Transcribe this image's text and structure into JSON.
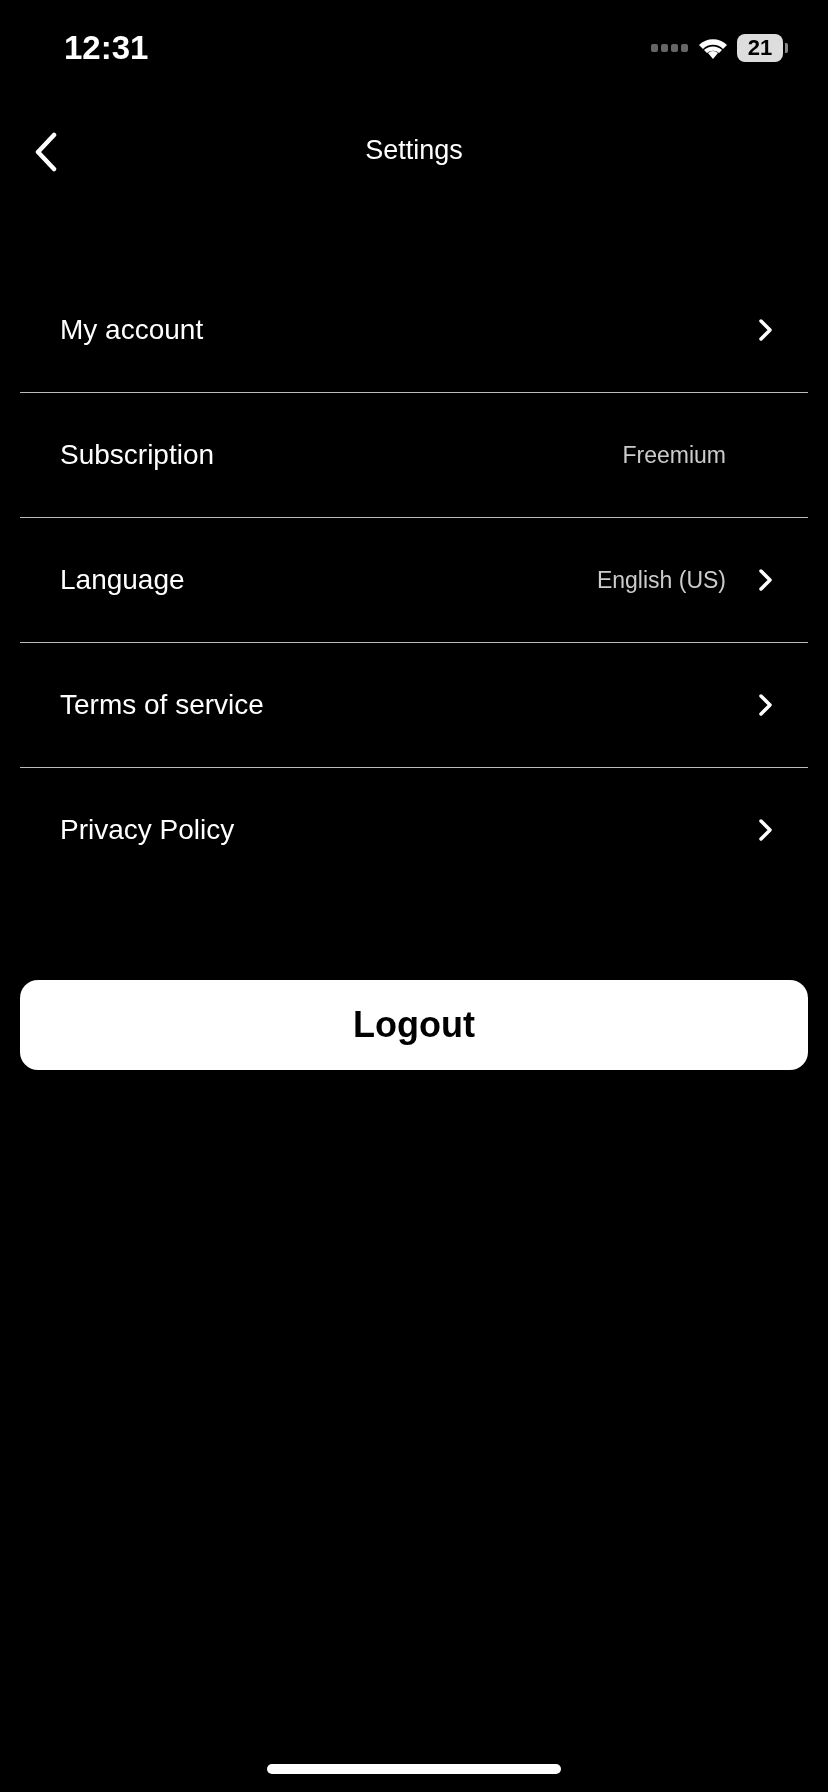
{
  "status_bar": {
    "time": "12:31",
    "battery": "21"
  },
  "header": {
    "title": "Settings"
  },
  "rows": [
    {
      "label": "My account",
      "chevron": true
    },
    {
      "label": "Subscription",
      "value": "Freemium",
      "chevron": false
    },
    {
      "label": "Language",
      "value": "English (US)",
      "chevron": true
    },
    {
      "label": "Terms of service",
      "chevron": true
    },
    {
      "label": "Privacy Policy",
      "chevron": true
    }
  ],
  "logout_button": {
    "label": "Logout"
  }
}
